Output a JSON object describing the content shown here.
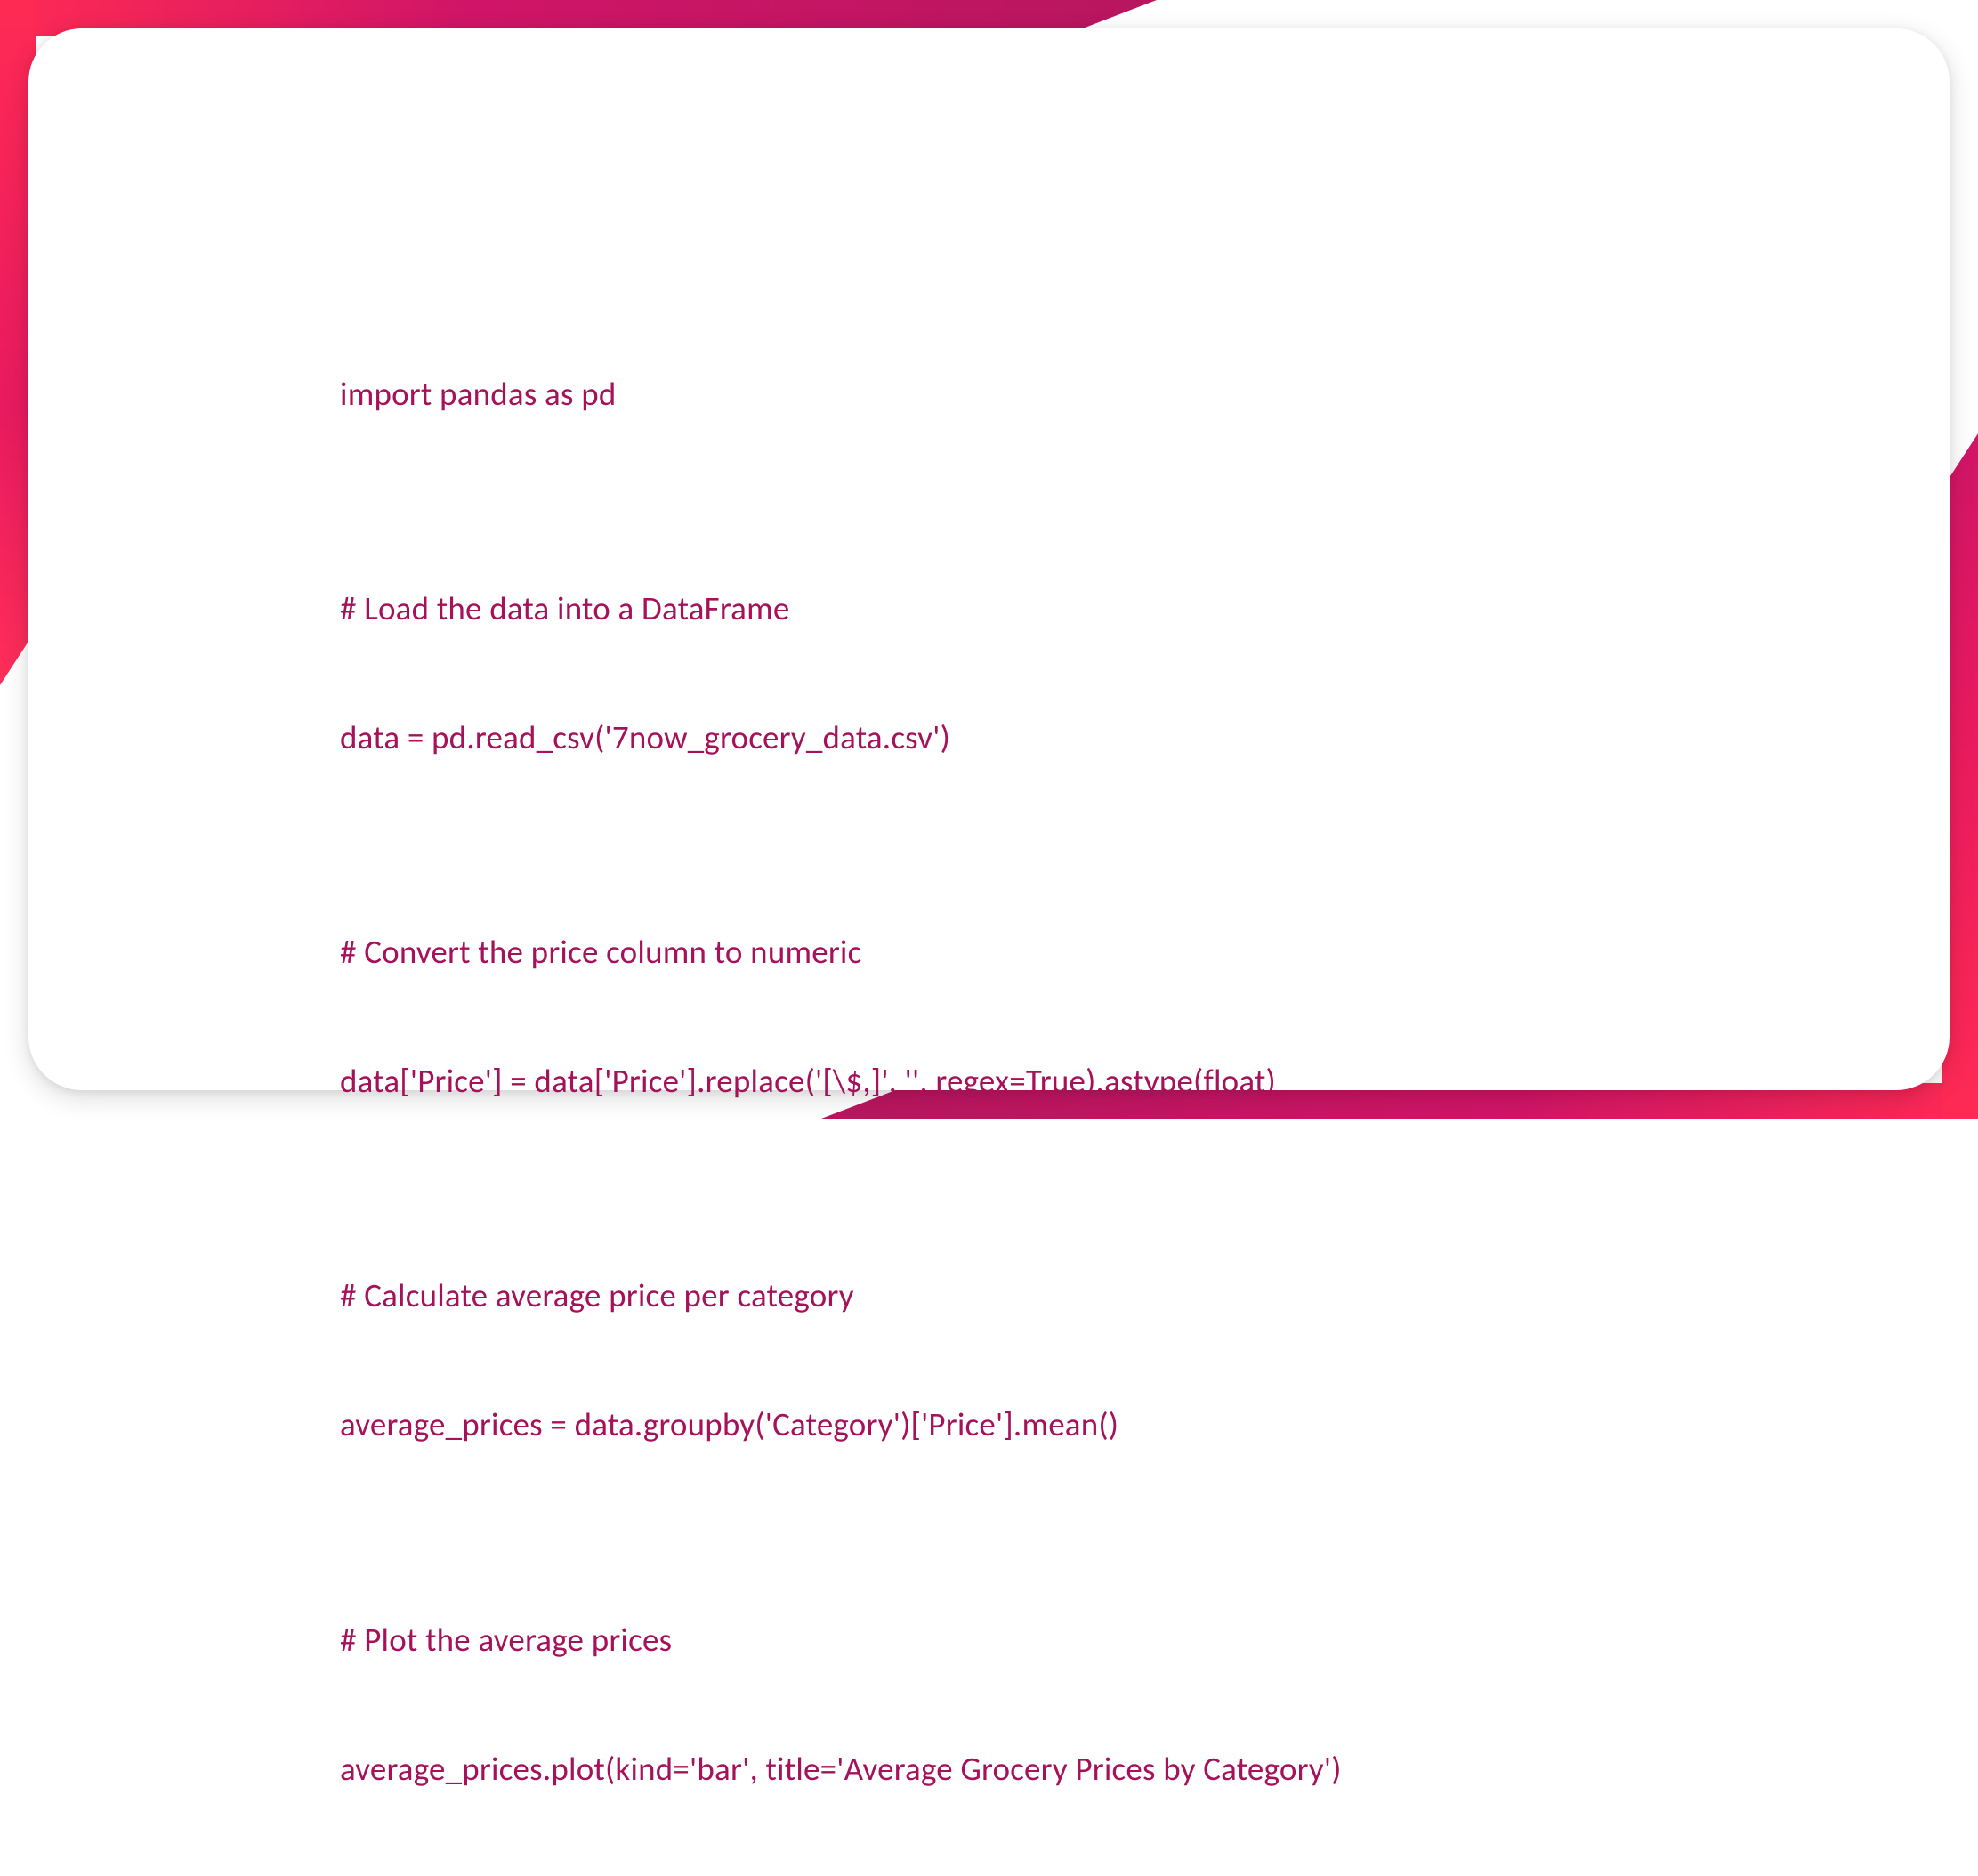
{
  "code": {
    "lines": [
      "import pandas as pd",
      "",
      "# Load the data into a DataFrame",
      "data = pd.read_csv('7now_grocery_data.csv')",
      "",
      "# Convert the price column to numeric",
      "data['Price'] = data['Price'].replace('[\\$,]', '', regex=True).astype(float)",
      "",
      "# Calculate average price per category",
      "average_prices = data.groupby('Category')['Price'].mean()",
      "",
      "# Plot the average prices",
      "average_prices.plot(kind='bar', title='Average Grocery Prices by Category')"
    ]
  },
  "colors": {
    "code_text": "#a6125a",
    "accent_gradient_start": "#ff2a54",
    "accent_gradient_end": "#b8165f"
  }
}
